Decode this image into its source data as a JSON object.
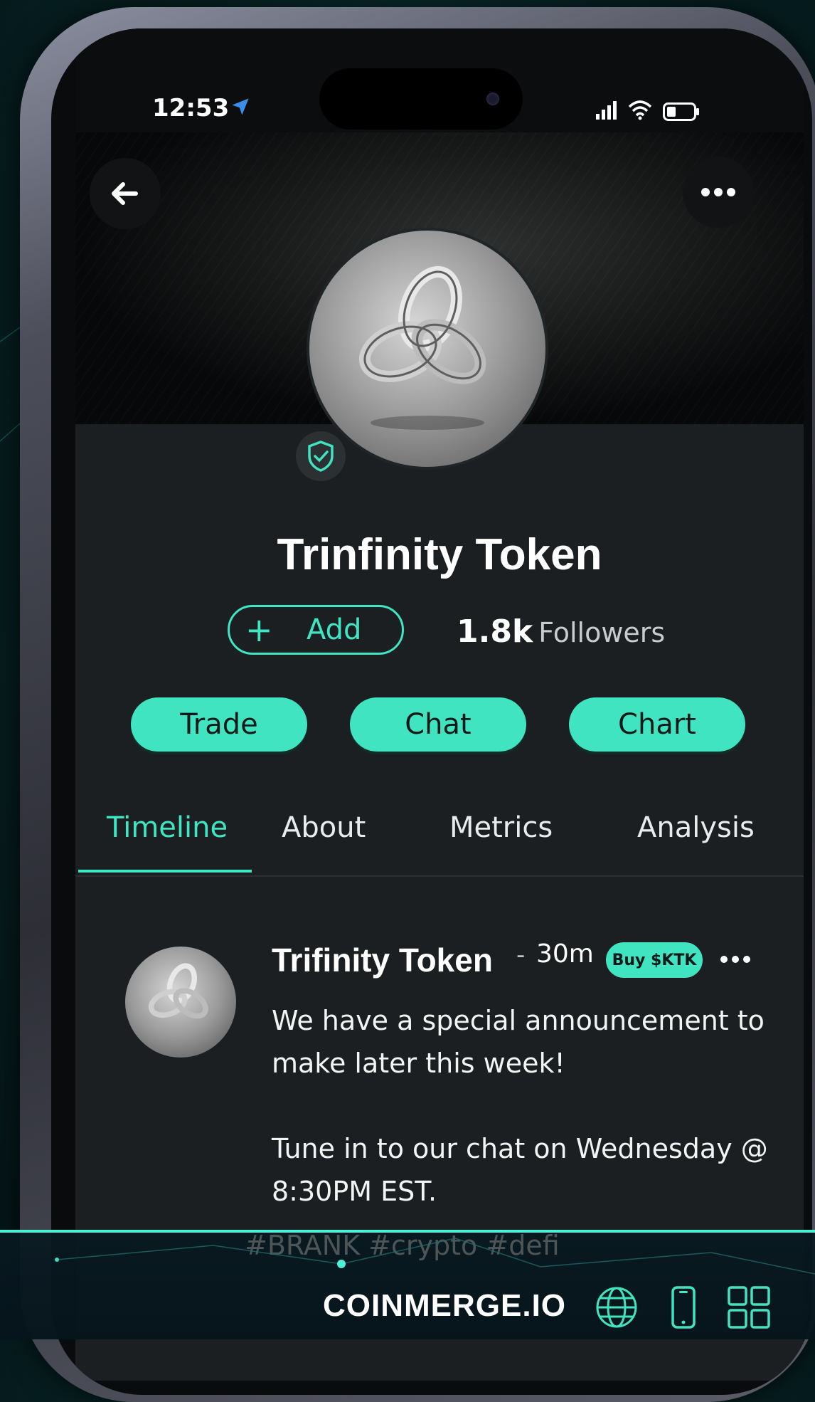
{
  "status_bar": {
    "time": "12:53"
  },
  "token": {
    "name": "Trinfinity Token",
    "add_label": "Add",
    "followers_count": "1.8k",
    "followers_label": "Followers"
  },
  "actions": {
    "trade": "Trade",
    "chat": "Chat",
    "chart": "Chart"
  },
  "tabs": [
    {
      "label": "Timeline",
      "active": true
    },
    {
      "label": "About",
      "active": false
    },
    {
      "label": "Metrics",
      "active": false
    },
    {
      "label": "Analysis",
      "active": false
    }
  ],
  "post": {
    "author": "Trifinity Token",
    "separator": "-",
    "time": "30m",
    "badge": "Buy $KTK",
    "line1": "We have a special announcement to",
    "line2": "make later this week!",
    "line3": "Tune in to our chat on Wednesday @",
    "line4": "8:30PM EST.",
    "hashtags": "#BRANK #crypto #defi"
  },
  "footer": {
    "brand": "COINMERGE.IO"
  },
  "colors": {
    "accent": "#40e4c0",
    "background": "#1b1f21",
    "footer_border": "#4ff0d6"
  }
}
